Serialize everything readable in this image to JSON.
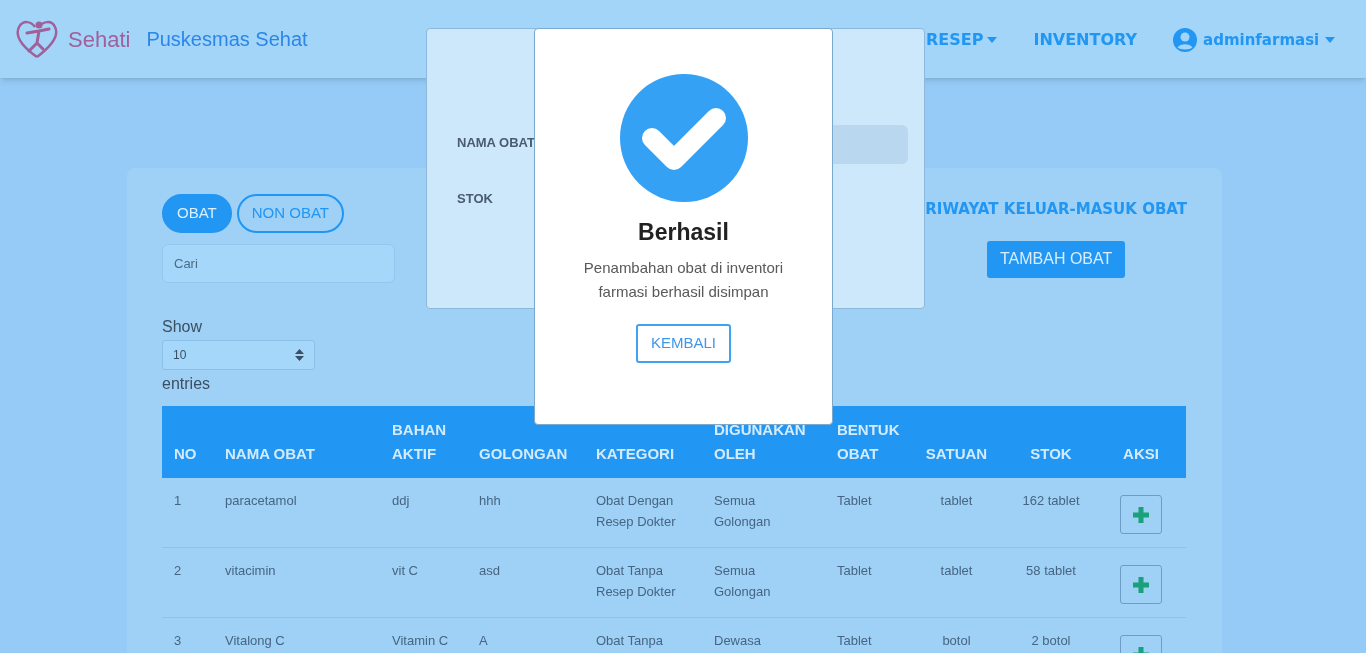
{
  "navbar": {
    "brand": "Sehati",
    "site_name": "Puskesmas Sehat",
    "menu": [
      {
        "label": "RESEP",
        "dropdown": true
      },
      {
        "label": "INVENTORY",
        "dropdown": false
      }
    ],
    "user": {
      "name": "adminfarmasi",
      "dropdown": true
    }
  },
  "tabs": [
    {
      "label": "OBAT",
      "selected": true
    },
    {
      "label": "NON OBAT",
      "selected": false
    }
  ],
  "search": {
    "placeholder": "Cari"
  },
  "history_link": "RIWAYAT KELUAR-MASUK OBAT",
  "add_button": "TAMBAH OBAT",
  "page_length": {
    "label_before": "Show",
    "value": "10",
    "label_after": "entries"
  },
  "table": {
    "columns": [
      "NO",
      "NAMA OBAT",
      "BAHAN AKTIF",
      "GOLONGAN",
      "KATEGORI",
      "DIGUNAKAN OLEH",
      "BENTUK OBAT",
      "SATUAN",
      "STOK",
      "AKSI"
    ],
    "rows": [
      {
        "cells": [
          "1",
          "paracetamol",
          "ddj",
          "hhh",
          "Obat Dengan Resep Dokter",
          "Semua Golongan",
          "Tablet",
          "tablet",
          "162 tablet"
        ]
      },
      {
        "cells": [
          "2",
          "vitacimin",
          "vit C",
          "asd",
          "Obat Tanpa Resep Dokter",
          "Semua Golongan",
          "Tablet",
          "tablet",
          "58 tablet"
        ]
      },
      {
        "cells": [
          "3",
          "Vitalong C",
          "Vitamin C",
          "A",
          "Obat Tanpa",
          "Dewasa",
          "Tablet",
          "botol",
          "2 botol"
        ]
      }
    ]
  },
  "form_modal": {
    "fields": [
      {
        "label": "NAMA OBAT"
      },
      {
        "label": "STOK"
      }
    ]
  },
  "success_dialog": {
    "title": "Berhasil",
    "message": "Penambahan obat di inventori farmasi berhasil disimpan",
    "button": "KEMBALI"
  }
}
